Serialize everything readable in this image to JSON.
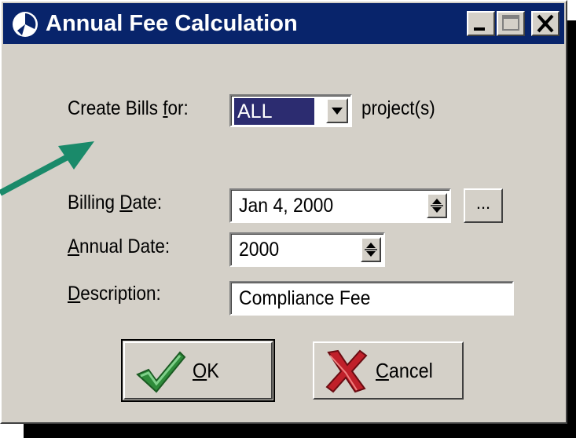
{
  "window": {
    "title": "Annual Fee Calculation",
    "accent_color": "#08246b",
    "icons": [
      "app-icon",
      "minimize-icon",
      "maximize-icon",
      "close-icon"
    ]
  },
  "form": {
    "create_bills": {
      "label_pre": "Create Bills ",
      "label_key": "f",
      "label_post": "or:",
      "selected": "ALL",
      "suffix": "project(s)"
    },
    "billing_date": {
      "label_pre": "Billing ",
      "label_key": "D",
      "label_post": "ate:",
      "value": "Jan 4, 2000",
      "browse_label": "..."
    },
    "annual_date": {
      "label_key": "A",
      "label_post": "nnual Date:",
      "value": "2000"
    },
    "description": {
      "label_key": "D",
      "label_post": "escription:",
      "value": "Compliance Fee"
    }
  },
  "buttons": {
    "ok": {
      "key": "O",
      "rest": "K",
      "icon": "checkmark-icon",
      "icon_color": "#2e8b3a"
    },
    "cancel": {
      "key": "C",
      "rest": "ancel",
      "icon": "x-mark-icon",
      "icon_color": "#c0202a"
    }
  },
  "annotation": {
    "arrow_color": "#1a8a6a",
    "icon": "pointer-arrow-icon"
  }
}
